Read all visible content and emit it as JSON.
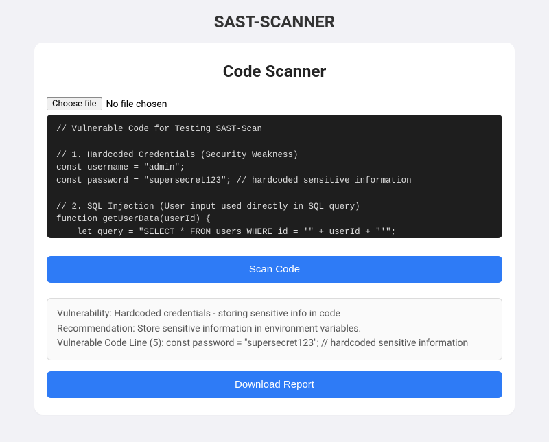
{
  "header": {
    "app_title": "SAST-SCANNER"
  },
  "card": {
    "title": "Code Scanner"
  },
  "file_input": {
    "button_label": "Choose file",
    "status_text": "No file chosen"
  },
  "code": {
    "value": "// Vulnerable Code for Testing SAST-Scan\n\n// 1. Hardcoded Credentials (Security Weakness)\nconst username = \"admin\";\nconst password = \"supersecret123\"; // hardcoded sensitive information\n\n// 2. SQL Injection (User input used directly in SQL query)\nfunction getUserData(userId) {\n    let query = \"SELECT * FROM users WHERE id = '\" + userId + \"'\";"
  },
  "actions": {
    "scan_label": "Scan Code",
    "download_label": "Download Report"
  },
  "results": {
    "vulnerability": "Vulnerability: Hardcoded credentials - storing sensitive info in code",
    "recommendation": "Recommendation: Store sensitive information in environment variables.",
    "code_line": "Vulnerable Code Line (5): const password = \"supersecret123\"; // hardcoded sensitive information"
  },
  "colors": {
    "primary": "#2e7bf6",
    "code_bg": "#1e1e1e",
    "code_fg": "#dcdcdc",
    "page_bg": "#f2f2f6"
  }
}
